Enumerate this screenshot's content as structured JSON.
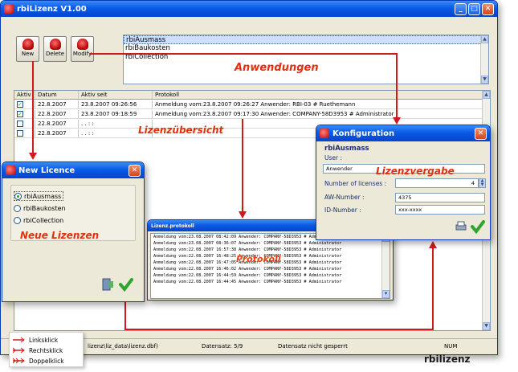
{
  "main_window": {
    "title": "rbiLizenz V1.00",
    "buttons": {
      "new": "New",
      "delete": "Delete",
      "modify": "Modify"
    },
    "applications": [
      "rbiAusmass",
      "rbiBaukosten",
      "rbiCollection"
    ]
  },
  "annotations": {
    "anwendungen": "Anwendungen",
    "lizenzuebersicht": "Lizenzübersicht",
    "neue_lizenzen": "Neue Lizenzen",
    "protokoll": "Protokoll",
    "lizenzvergabe": "Lizenzvergabe"
  },
  "grid": {
    "headers": [
      "Aktiv",
      "Datum",
      "Aktiv seit",
      "Protokoll"
    ],
    "rows": [
      {
        "checked": true,
        "datum": "22.8.2007",
        "aktiv_seit": "23.8.2007 09:26:56",
        "protokoll": "Anmeldung vom:23.8.2007 09:26:27 Anwender: RBI-03 # Ruethemann"
      },
      {
        "checked": true,
        "datum": "22.8.2007",
        "aktiv_seit": "23.8.2007 09:18:59",
        "protokoll": "Anmeldung vom:23.8.2007 09:17:30 Anwender: COMPANY-58D3953 # Administrator"
      },
      {
        "checked": false,
        "datum": "22.8.2007",
        "aktiv_seit": ". .   : :",
        "protokoll": ""
      },
      {
        "checked": false,
        "datum": "22.8.2007",
        "aktiv_seit": ". .   : :",
        "protokoll": ""
      }
    ]
  },
  "status_bar": {
    "path": "lizenz\\liz_data\\lizenz.dbf)",
    "datensatz": "Datensatz: 5/9",
    "gesperrt": "Datensatz nicht gesperrt",
    "num": "NUM"
  },
  "new_licence_dialog": {
    "title": "New Licence",
    "options": [
      "rbiAusmass",
      "rbiBaukosten",
      "rbiCollection"
    ],
    "selected": "rbiAusmass"
  },
  "protocol_window": {
    "title": "Lizenz.protokoll",
    "lines": [
      "Anmeldung vom:23.08.2007 08:42:09 Anwender: COMPANY-58D3953 # Administrator",
      "Anmeldung vom:23.08.2007 08:36:07 Anwender: COMPANY-58D3953 # Administrator",
      "Anmeldung vom:22.08.2007 16:57:38 Anwender: COMPANY-58D3953 # Administrator",
      "Anmeldung vom:22.08.2007 16:48:25 Anwender: COMPANY-58D3953 # Administrator",
      "Anmeldung vom:22.08.2007 16:47:05 Anwender: COMPANY-58D3953 # Administrator",
      "Anmeldung vom:22.08.2007 16:46:02 Anwender: COMPANY-58D3953 # Administrator",
      "Anmeldung vom:22.08.2007 16:44:59 Anwender: COMPANY-58D3953 # Administrator",
      "Anmeldung vom:22.08.2007 16:44:45 Anwender: COMPANY-58D3953 # Administrator"
    ]
  },
  "konfiguration_dialog": {
    "title": "Konfiguration",
    "app_name": "rbiAusmass",
    "user_label": "User :",
    "user_value": "Anwender",
    "licenses_label": "Number of licenses :",
    "licenses_value": "4",
    "aw_label": "AW-Number :",
    "aw_value": "4375",
    "id_label": "ID-Number :",
    "id_value": "xxx-xxxx"
  },
  "legend": {
    "items": [
      "Linksklick",
      "Rechtsklick",
      "Doppelklick"
    ]
  },
  "brand": "rbilizenz",
  "colors": {
    "annotation": "#e03010",
    "arrow": "#d21a1a",
    "titlebar": "#0a5ae8"
  }
}
